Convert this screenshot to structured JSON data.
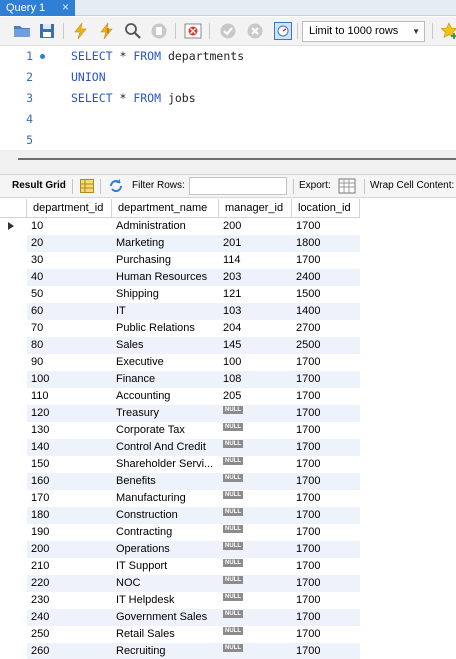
{
  "tab": {
    "title": "Query 1",
    "close": "×"
  },
  "toolbar": {
    "limit_label": "Limit to 1000 rows",
    "icons": [
      "open-folder-icon",
      "save-icon",
      "execute-icon",
      "execute-current-icon",
      "explain-icon",
      "stop-icon",
      "toggle-error-icon",
      "commit-icon",
      "rollback-icon",
      "autocommit-icon",
      "add-snippet-icon"
    ]
  },
  "editor": {
    "lines": [
      {
        "num": "1",
        "parts": [
          {
            "t": "SELECT",
            "kw": true
          },
          {
            "t": " * ",
            "kw": false
          },
          {
            "t": "FROM",
            "kw": true
          },
          {
            "t": " departments",
            "kw": false
          }
        ]
      },
      {
        "num": "2",
        "parts": [
          {
            "t": "UNION",
            "kw": true
          }
        ]
      },
      {
        "num": "3",
        "parts": [
          {
            "t": "SELECT",
            "kw": true
          },
          {
            "t": " * ",
            "kw": false
          },
          {
            "t": "FROM",
            "kw": true
          },
          {
            "t": " jobs",
            "kw": false
          }
        ]
      },
      {
        "num": "4",
        "parts": []
      },
      {
        "num": "5",
        "parts": []
      }
    ]
  },
  "result_toolbar": {
    "result_grid": "Result Grid",
    "filter_rows": "Filter Rows:",
    "filter_value": "",
    "export": "Export:",
    "wrap": "Wrap Cell Content:"
  },
  "grid": {
    "columns": [
      "department_id",
      "department_name",
      "manager_id",
      "location_id"
    ],
    "null_label": "NULL",
    "rows": [
      [
        "10",
        "Administration",
        "200",
        "1700"
      ],
      [
        "20",
        "Marketing",
        "201",
        "1800"
      ],
      [
        "30",
        "Purchasing",
        "114",
        "1700"
      ],
      [
        "40",
        "Human Resources",
        "203",
        "2400"
      ],
      [
        "50",
        "Shipping",
        "121",
        "1500"
      ],
      [
        "60",
        "IT",
        "103",
        "1400"
      ],
      [
        "70",
        "Public Relations",
        "204",
        "2700"
      ],
      [
        "80",
        "Sales",
        "145",
        "2500"
      ],
      [
        "90",
        "Executive",
        "100",
        "1700"
      ],
      [
        "100",
        "Finance",
        "108",
        "1700"
      ],
      [
        "110",
        "Accounting",
        "205",
        "1700"
      ],
      [
        "120",
        "Treasury",
        null,
        "1700"
      ],
      [
        "130",
        "Corporate Tax",
        null,
        "1700"
      ],
      [
        "140",
        "Control And Credit",
        null,
        "1700"
      ],
      [
        "150",
        "Shareholder Servi...",
        null,
        "1700"
      ],
      [
        "160",
        "Benefits",
        null,
        "1700"
      ],
      [
        "170",
        "Manufacturing",
        null,
        "1700"
      ],
      [
        "180",
        "Construction",
        null,
        "1700"
      ],
      [
        "190",
        "Contracting",
        null,
        "1700"
      ],
      [
        "200",
        "Operations",
        null,
        "1700"
      ],
      [
        "210",
        "IT Support",
        null,
        "1700"
      ],
      [
        "220",
        "NOC",
        null,
        "1700"
      ],
      [
        "230",
        "IT Helpdesk",
        null,
        "1700"
      ],
      [
        "240",
        "Government Sales",
        null,
        "1700"
      ],
      [
        "250",
        "Retail Sales",
        null,
        "1700"
      ],
      [
        "260",
        "Recruiting",
        null,
        "1700"
      ]
    ]
  }
}
